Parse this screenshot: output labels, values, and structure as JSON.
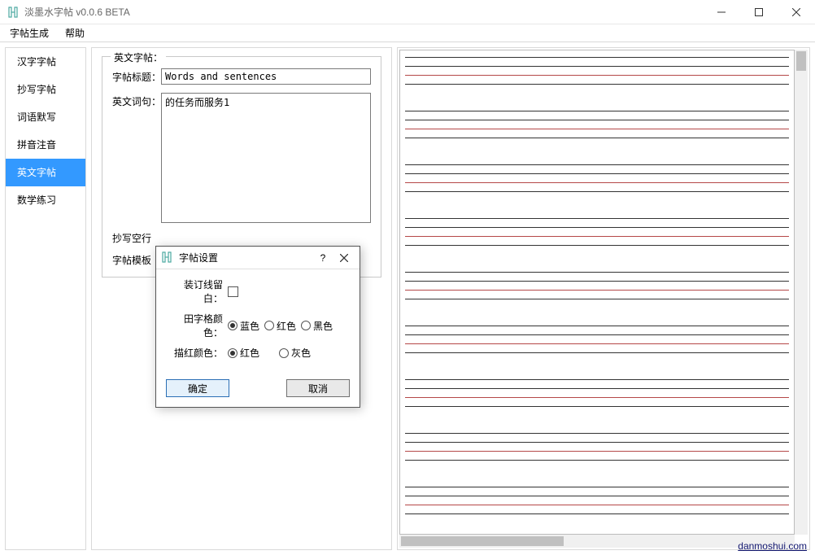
{
  "window": {
    "title": "淡墨水字帖 v0.0.6 BETA"
  },
  "menubar": {
    "generate": "字帖生成",
    "help": "帮助"
  },
  "sidebar": {
    "items": [
      {
        "label": "汉字字帖"
      },
      {
        "label": "抄写字帖"
      },
      {
        "label": "词语默写"
      },
      {
        "label": "拼音注音"
      },
      {
        "label": "英文字帖"
      },
      {
        "label": "数学练习"
      }
    ],
    "active_index": 4
  },
  "form": {
    "legend": "英文字帖：",
    "title_label": "字帖标题：",
    "title_value": "Words and sentences",
    "words_label": "英文词句：",
    "words_value": "的任务而服务1",
    "blank_lines_label": "抄写空行",
    "template_label": "字帖模板"
  },
  "dialog": {
    "title": "字帖设置",
    "binding_margin_label": "装订线留白：",
    "binding_margin_checked": false,
    "grid_color_label": "田字格颜色：",
    "grid_color_options": [
      "蓝色",
      "红色",
      "黑色"
    ],
    "grid_color_selected": "蓝色",
    "trace_color_label": "描红颜色：",
    "trace_color_options": [
      "红色",
      "灰色"
    ],
    "trace_color_selected": "红色",
    "ok_label": "确定",
    "cancel_label": "取消"
  },
  "footer": {
    "link_text": "danmoshui.com"
  }
}
